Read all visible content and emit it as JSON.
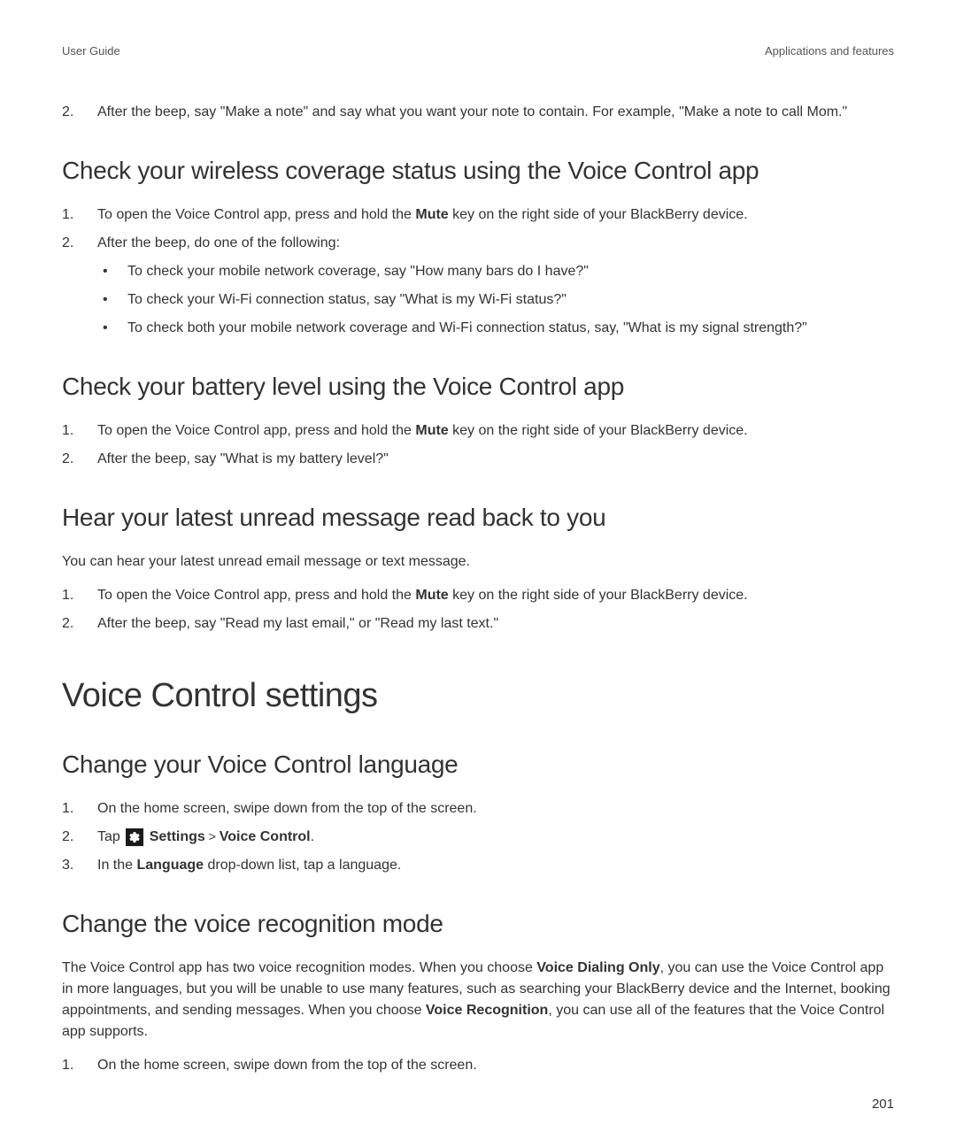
{
  "header": {
    "left": "User Guide",
    "right": "Applications and features"
  },
  "intro_step": {
    "num": "2.",
    "text": "After the beep, say \"Make a note\" and say what you want your note to contain. For example, \"Make a note to call Mom.\""
  },
  "section1": {
    "title": "Check your wireless coverage status using the Voice Control app",
    "steps": [
      {
        "num": "1.",
        "prefix": "To open the Voice Control app, press and hold the ",
        "bold": "Mute",
        "suffix": " key on the right side of your BlackBerry device."
      },
      {
        "num": "2.",
        "text": "After the beep, do one of the following:"
      }
    ],
    "bullets": [
      "To check your mobile network coverage, say \"How many bars do I have?\"",
      "To check your Wi-Fi connection status, say \"What is my Wi-Fi status?\"",
      "To check both your mobile network coverage and Wi-Fi connection status, say, \"What is my signal strength?\""
    ]
  },
  "section2": {
    "title": "Check your battery level using the Voice Control app",
    "steps": [
      {
        "num": "1.",
        "prefix": "To open the Voice Control app, press and hold the ",
        "bold": "Mute",
        "suffix": " key on the right side of your BlackBerry device."
      },
      {
        "num": "2.",
        "text": "After the beep, say \"What is my battery level?\""
      }
    ]
  },
  "section3": {
    "title": "Hear your latest unread message read back to you",
    "intro": "You can hear your latest unread email message or text message.",
    "steps": [
      {
        "num": "1.",
        "prefix": "To open the Voice Control app, press and hold the ",
        "bold": "Mute",
        "suffix": " key on the right side of your BlackBerry device."
      },
      {
        "num": "2.",
        "text": "After the beep, say \"Read my last email,\" or \"Read my last text.\""
      }
    ]
  },
  "main_heading": "Voice Control settings",
  "section4": {
    "title": "Change your Voice Control language",
    "steps": [
      {
        "num": "1.",
        "text": "On the home screen, swipe down from the top of the screen."
      },
      {
        "num": "2.",
        "tap": "Tap ",
        "settings": "Settings",
        "gt": " > ",
        "voice": "Voice Control",
        "period": "."
      },
      {
        "num": "3.",
        "prefix": "In the ",
        "bold": "Language",
        "suffix": " drop-down list, tap a language."
      }
    ]
  },
  "section5": {
    "title": "Change the voice recognition mode",
    "intro_p1": "The Voice Control app has two voice recognition modes. When you choose ",
    "intro_b1": "Voice Dialing Only",
    "intro_p2": ", you can use the Voice Control app in more languages, but you will be unable to use many features, such as searching your BlackBerry device and the Internet, booking appointments, and sending messages. When you choose ",
    "intro_b2": "Voice Recognition",
    "intro_p3": ", you can use all of the features that the Voice Control app supports.",
    "steps": [
      {
        "num": "1.",
        "text": "On the home screen, swipe down from the top of the screen."
      }
    ]
  },
  "page_number": "201"
}
